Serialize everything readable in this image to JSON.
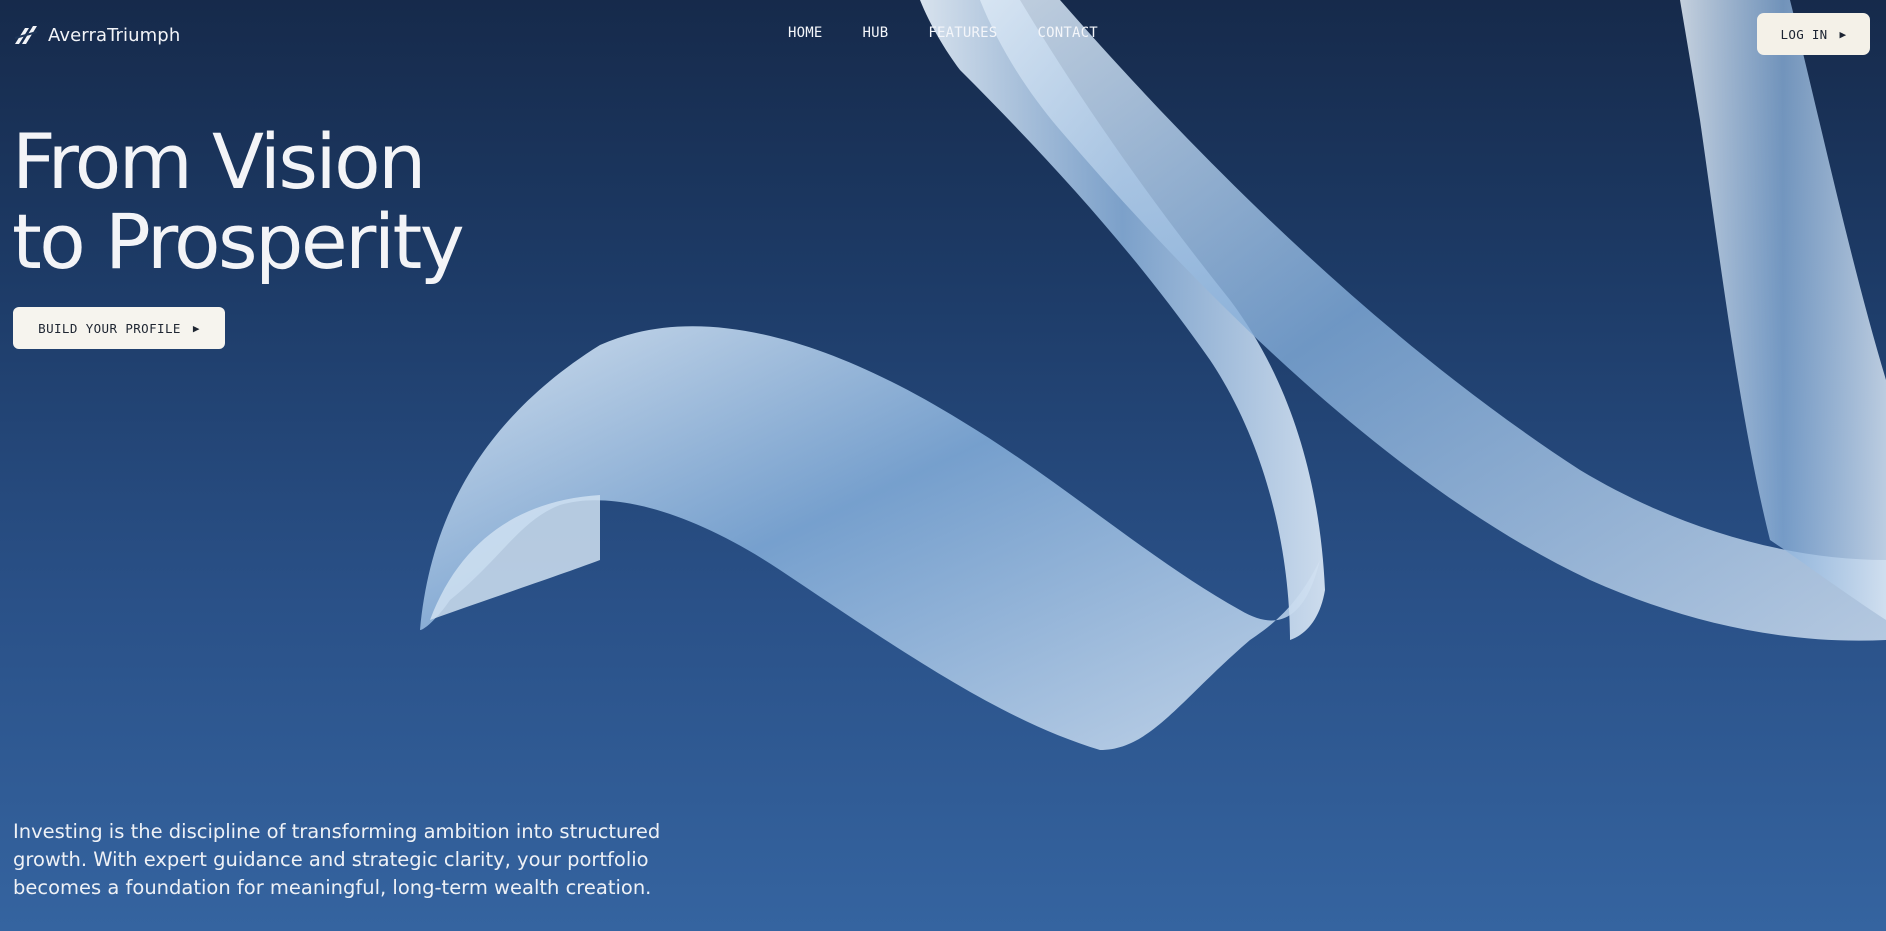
{
  "brand": {
    "name": "AverraTriumph",
    "logo_icon": "slash-stripes-logo-icon"
  },
  "nav": {
    "items": [
      {
        "label": "HOME"
      },
      {
        "label": "HUB"
      },
      {
        "label": "FEATURES"
      },
      {
        "label": "CONTACT"
      }
    ]
  },
  "header": {
    "login_label": "LOG IN",
    "login_icon": "play-arrow-icon"
  },
  "hero": {
    "title_line1": "From Vision",
    "title_line2": "to Prosperity",
    "cta_label": "BUILD YOUR PROFILE",
    "cta_icon": "play-arrow-icon"
  },
  "intro": {
    "text": "Investing is the discipline of transforming ambition into structured growth. With expert guidance and strategic clarity, your portfolio becomes a foundation for meaningful, long-term wealth creation."
  },
  "colors": {
    "background_top": "#162a4b",
    "background_bottom": "#3564a0",
    "button_bg": "#f4f1e8",
    "ribbon": "#9fc0e2"
  }
}
